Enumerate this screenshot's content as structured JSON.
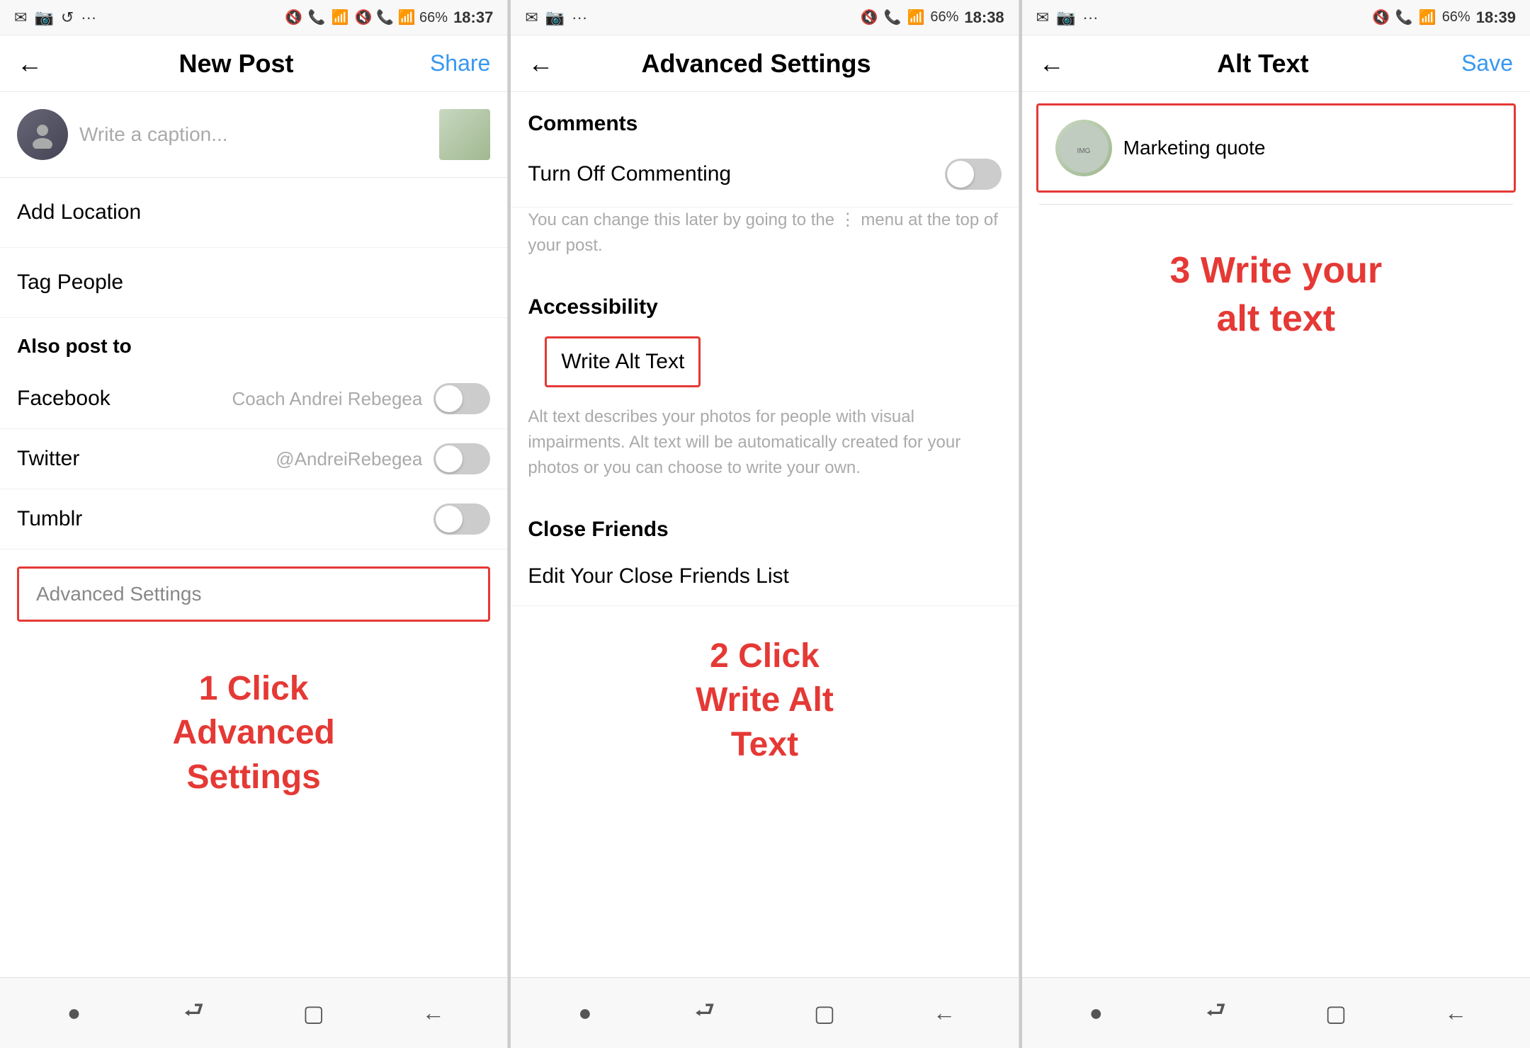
{
  "panel1": {
    "statusBar": {
      "leftIcons": "✉ 📷 ↺ ···",
      "rightIcons": "🔇 📞 📶 66%",
      "time": "18:37"
    },
    "nav": {
      "title": "New Post",
      "action": "Share",
      "backIcon": "←"
    },
    "caption": {
      "placeholder": "Write a caption..."
    },
    "menuItems": [
      {
        "label": "Add Location"
      },
      {
        "label": "Tag People"
      }
    ],
    "alsoPostTo": {
      "title": "Also post to",
      "items": [
        {
          "name": "Facebook",
          "account": "Coach Andrei Rebegea",
          "on": false
        },
        {
          "name": "Twitter",
          "account": "@AndreiRebegea",
          "on": false
        },
        {
          "name": "Tumblr",
          "account": "",
          "on": false
        }
      ]
    },
    "advancedSettings": {
      "label": "Advanced Settings"
    },
    "annotation": "1 Click\nAdvanced\nSettings"
  },
  "panel2": {
    "statusBar": {
      "time": "18:38"
    },
    "nav": {
      "title": "Advanced Settings",
      "backIcon": "←"
    },
    "comments": {
      "sectionTitle": "Comments",
      "toggleLabel": "Turn Off Commenting",
      "hint": "You can change this later by going to the ⋮ menu at the top of your post."
    },
    "accessibility": {
      "sectionTitle": "Accessibility",
      "writeAltText": "Write Alt Text",
      "description": "Alt text describes your photos for people with visual impairments. Alt text will be automatically created for your photos or you can choose to write your own."
    },
    "closeFriends": {
      "sectionTitle": "Close Friends",
      "editLabel": "Edit Your Close Friends List"
    },
    "annotation": "2 Click\nWrite Alt\nText"
  },
  "panel3": {
    "statusBar": {
      "time": "18:39"
    },
    "nav": {
      "title": "Alt Text",
      "action": "Save",
      "backIcon": "←"
    },
    "imageCaption": "Marketing quote",
    "annotation": "3 Write your\nalt text"
  },
  "bottomNav": {
    "icons": [
      "●",
      "⮐",
      "▢",
      "←"
    ]
  }
}
